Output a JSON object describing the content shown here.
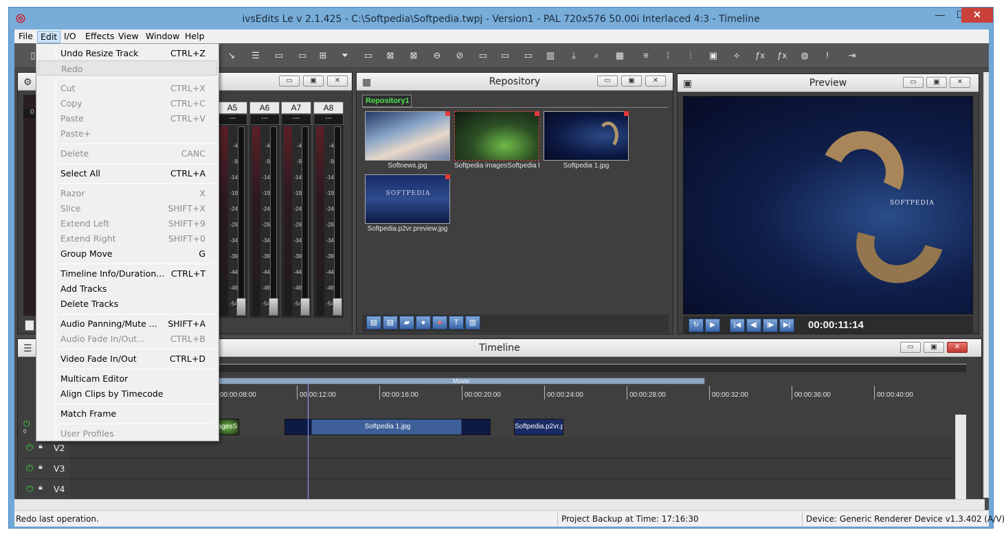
{
  "window": {
    "title": "ivsEdits Le v 2.1.425 - C:\\Softpedia\\Softpedia.twpj - Version1 - PAL  720x576 50.00i Interlaced 4:3 - Timeline",
    "min_glyph": "—",
    "max_glyph": "☐",
    "close_glyph": "✕"
  },
  "menubar": {
    "file": "File",
    "edit": "Edit",
    "io": "I/O",
    "effects": "Effects",
    "view": "View",
    "window": "Window",
    "help": "Help"
  },
  "edit_menu": {
    "items": [
      {
        "label": "Undo Resize Track",
        "shortcut": "CTRL+Z",
        "enabled": true
      },
      {
        "label": "Redo",
        "shortcut": "",
        "enabled": false
      },
      {
        "label": "Cut",
        "shortcut": "CTRL+X",
        "enabled": false
      },
      {
        "label": "Copy",
        "shortcut": "CTRL+C",
        "enabled": false
      },
      {
        "label": "Paste",
        "shortcut": "CTRL+V",
        "enabled": false
      },
      {
        "label": "Paste+",
        "shortcut": "",
        "enabled": false
      },
      {
        "label": "Delete",
        "shortcut": "CANC",
        "enabled": false
      },
      {
        "label": "Select All",
        "shortcut": "CTRL+A",
        "enabled": true
      },
      {
        "label": "Razor",
        "shortcut": "X",
        "enabled": false
      },
      {
        "label": "Slice",
        "shortcut": "SHIFT+X",
        "enabled": false
      },
      {
        "label": "Extend Left",
        "shortcut": "SHIFT+9",
        "enabled": false
      },
      {
        "label": "Extend Right",
        "shortcut": "SHIFT+0",
        "enabled": false
      },
      {
        "label": "Group Move",
        "shortcut": "G",
        "enabled": true
      },
      {
        "label": "Timeline Info/Duration...",
        "shortcut": "CTRL+T",
        "enabled": true
      },
      {
        "label": "Add Tracks",
        "shortcut": "",
        "enabled": true
      },
      {
        "label": "Delete Tracks",
        "shortcut": "",
        "enabled": true
      },
      {
        "label": "Audio Panning/Mute ...",
        "shortcut": "SHIFT+A",
        "enabled": true
      },
      {
        "label": "Audio Fade In/Out...",
        "shortcut": "CTRL+B",
        "enabled": false
      },
      {
        "label": "Video Fade In/Out",
        "shortcut": "CTRL+D",
        "enabled": true
      },
      {
        "label": "Multicam Editor",
        "shortcut": "",
        "enabled": true
      },
      {
        "label": "Align Clips by Timecode",
        "shortcut": "",
        "enabled": true
      },
      {
        "label": "Match Frame",
        "shortcut": "",
        "enabled": true
      },
      {
        "label": "User Profiles",
        "shortcut": "",
        "enabled": false
      }
    ]
  },
  "mixer": {
    "channels": [
      "A5",
      "A6",
      "A7",
      "A8"
    ],
    "sub_value": "---",
    "scale": [
      "-4",
      "-9",
      "-14",
      "-19",
      "-24",
      "-29",
      "-34",
      "-39",
      "-44",
      "-49",
      "-54"
    ],
    "partial_label": "0"
  },
  "repository": {
    "title": "Repository",
    "tab": "Repository1",
    "items": [
      "Softnews.jpg",
      "Softpedia imagesSoftpedia fo",
      "Softpedia 1.jpg",
      "Softpedia.p2vr.preview.jpg"
    ],
    "thumb_logo_text": "SOFTPEDIA"
  },
  "preview": {
    "title": "Preview",
    "timecode": "00:00:11:14",
    "logo_text": "SOFTPEDIA"
  },
  "timeline": {
    "title": "Timeline",
    "movie_label": "Movie",
    "ruler": [
      "00:00:08:00",
      "00:00:12:00",
      "00:00:16:00",
      "00:00:20:00",
      "00:00:24:00",
      "00:00:28:00",
      "00:00:32:00",
      "00:00:36:00",
      "00:00:40:00"
    ],
    "tracks": [
      "V2",
      "V3",
      "V4"
    ],
    "clips": [
      "agesS",
      "Softpedia 1.jpg",
      "Softpedia.p2vr.pr"
    ],
    "track1_label": "0"
  },
  "statusbar": {
    "message": "Redo last operation.",
    "backup": "Project Backup at Time: 17:16:30",
    "device": "Device: Generic Renderer Device v1.3.402 (A/V)"
  },
  "colors": {
    "accent_green": "#4fe24f",
    "close_red": "#c9413a"
  }
}
